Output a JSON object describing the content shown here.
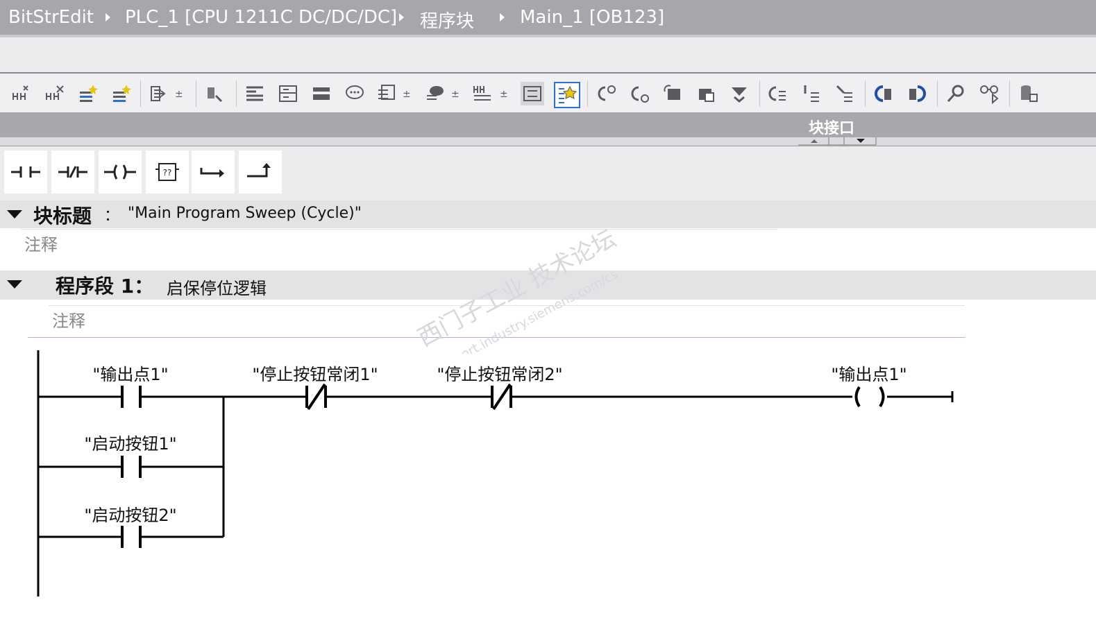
{
  "breadcrumb": [
    "BitStrEdit",
    "PLC_1 [CPU 1211C DC/DC/DC]",
    "程序块",
    "Main_1 [OB123]"
  ],
  "toolbar_icons": [
    "insert-network-icon",
    "delete-network-icon",
    "insert-row-icon",
    "add-row-icon",
    "download-icon",
    "test-icon",
    "absolute-addr-icon",
    "symbolic-addr-icon",
    "network-view-icon",
    "comment-icon",
    "operand-display-icon",
    "tag-info-icon",
    "symbol-info-icon",
    "networks-collapse-icon",
    "favorites-icon",
    "goto-error-icon",
    "goto-next-error-icon",
    "monitor-icon",
    "monitor-all-icon",
    "breakpoint-icon",
    "step-icon",
    "show-step-icon",
    "compare-icon",
    "compare-next-icon",
    "refresh-icon",
    "settings-icon",
    "simulation-icon",
    "database-icon"
  ],
  "interface_bar": {
    "label": "块接口"
  },
  "palette": [
    "normally-open-contact",
    "normally-closed-contact",
    "output-coil",
    "empty-box",
    "open-branch",
    "close-branch"
  ],
  "block_title": {
    "label": "块标题",
    "colon": "：",
    "value": "\"Main Program Sweep (Cycle)\"",
    "comment": "注释"
  },
  "network": {
    "label": "程序段 1：",
    "title": "启保停位逻辑",
    "comment": "注释"
  },
  "ladder": {
    "contact_output_point": "\"输出点1\"",
    "contact_stop_1": "\"停止按钮常闭1\"",
    "contact_stop_2": "\"停止按钮常闭2\"",
    "coil_output_point": "\"输出点1\"",
    "contact_start_1": "\"启动按钮1\"",
    "contact_start_2": "\"启动按钮2\""
  },
  "watermark": {
    "line1": "西门子工业 技术论坛",
    "line2": "support.industry.siemens.com/cs"
  }
}
